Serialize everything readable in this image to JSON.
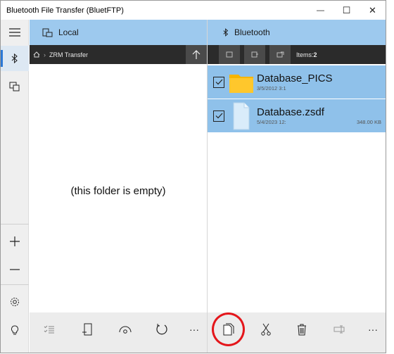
{
  "window": {
    "title": "Bluetooth File Transfer (BluetFTP)",
    "minimize": "—",
    "maximize": "☐",
    "close": "✕"
  },
  "left_pane": {
    "header_label": "Local",
    "path": "ZRM Transfer",
    "empty_text": "(this folder is empty)"
  },
  "right_pane": {
    "header_label": "Bluetooth",
    "items_label": "Items:",
    "items_count": "2",
    "files": [
      {
        "name": "Database_PICS",
        "date": "3/5/2012 3:1",
        "size": "",
        "type": "folder"
      },
      {
        "name": "Database.zsdf",
        "date": "5/4/2023 12:",
        "size": "348.00 KB",
        "type": "file"
      }
    ]
  },
  "colors": {
    "accent": "#2b78d6",
    "header_blue": "#9dc9ee",
    "selected_row": "#8fc1ea",
    "path_bar": "#2b2b2b",
    "highlight_circle": "#e4161b"
  },
  "icons": {
    "rail": [
      "hamburger-icon",
      "bluetooth-icon",
      "device-icon",
      "add-icon",
      "remove-icon",
      "settings-icon",
      "lightbulb-icon"
    ],
    "left_toolbar": [
      "multiselect-icon",
      "new-folder-icon",
      "preview-icon",
      "refresh-icon",
      "more-icon"
    ],
    "right_toolbar": [
      "copy-icon",
      "cut-icon",
      "delete-icon",
      "rename-icon",
      "more-icon"
    ]
  }
}
